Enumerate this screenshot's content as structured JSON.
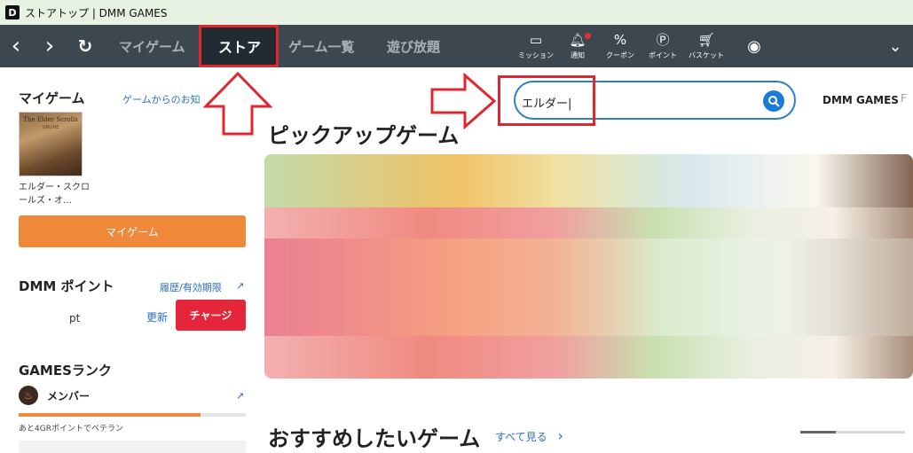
{
  "window": {
    "app_icon": "D",
    "title": "ストアトップ | DMM GAMES"
  },
  "nav": {
    "back_icon": "‹",
    "forward_icon": "›",
    "reload_icon": "↻",
    "tabs": [
      {
        "label": "マイゲーム"
      },
      {
        "label": "ストア"
      },
      {
        "label": "ゲーム一覧"
      },
      {
        "label": "遊び放題"
      }
    ],
    "icons": [
      {
        "name": "mission-icon",
        "glyph": "▭",
        "label": "ミッション"
      },
      {
        "name": "bell-icon",
        "glyph": "🔔︎",
        "label": "通知"
      },
      {
        "name": "coupon-icon",
        "glyph": "%",
        "label": "クーポン"
      },
      {
        "name": "point-icon",
        "glyph": "Ⓟ",
        "label": "ポイント"
      },
      {
        "name": "cart-icon",
        "glyph": "🛒︎",
        "label": "バスケット"
      }
    ],
    "account_icon": "◉",
    "chevron_icon": "⌄"
  },
  "sidebar": {
    "mygame": {
      "title": "マイゲーム",
      "notice_link": "ゲームからのお知",
      "thumb_title": "The Elder Scrolls",
      "thumb_sub": "ONLINE",
      "game_name": "エルダー・スクロールズ・オ…",
      "button": "マイゲーム"
    },
    "points": {
      "title": "DMM ポイント",
      "history_link": "履歴/有効期限",
      "ext_icon": "↗",
      "value_text": "pt",
      "refresh_link": "更新",
      "charge_button": "チャージ"
    },
    "rank": {
      "title": "GAMESランク",
      "rank_name": "メンバー",
      "ext_icon": "↗",
      "progress": 0.8,
      "progress_text": "あと4GRポイントでベテラン"
    }
  },
  "main": {
    "search": {
      "value": "エルダー|",
      "button_icon": "⚲"
    },
    "brand_link": "DMM GAMES",
    "brand_sep": "F",
    "pickup_title": "ピックアップゲーム",
    "recommend_title": "おすすめしたいゲーム",
    "see_all": "すべて見る",
    "see_all_icon": "›"
  },
  "annotation_colors": {
    "red": "#e0262e"
  }
}
